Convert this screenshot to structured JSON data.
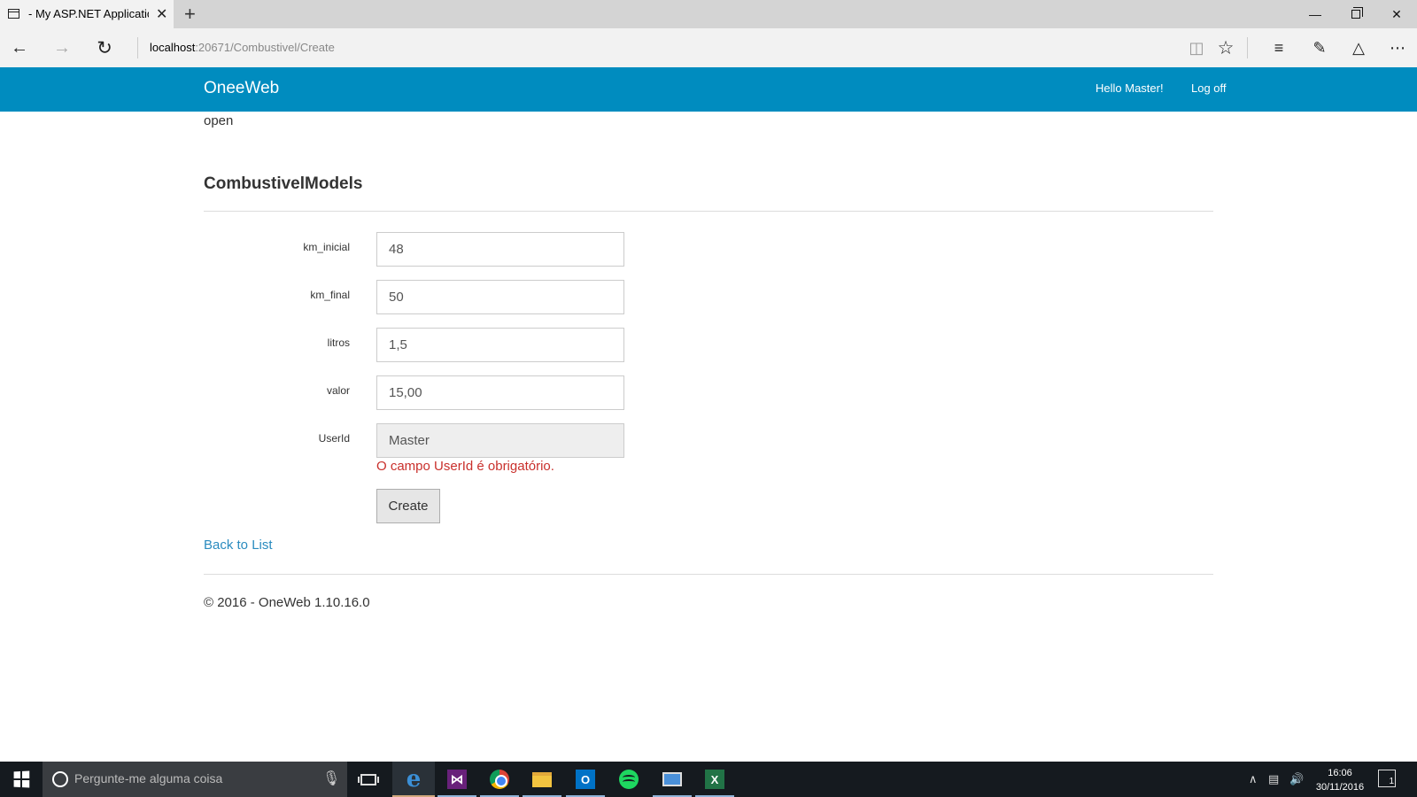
{
  "browser": {
    "tab_title": "- My ASP.NET Applicatio",
    "tab_close": "✕",
    "new_tab": "+",
    "url_host": "localhost",
    "url_rest": ":20671/Combustivel/Create",
    "window_minimize": "—",
    "window_close": "✕"
  },
  "site": {
    "brand": "OneeWeb",
    "hello": "Hello Master!",
    "logoff": "Log off"
  },
  "page": {
    "status_text": "open",
    "heading": "CombustivelModels",
    "fields": [
      {
        "label": "km_inicial",
        "value": "48"
      },
      {
        "label": "km_final",
        "value": "50"
      },
      {
        "label": "litros",
        "value": "1,5"
      },
      {
        "label": "valor",
        "value": "15,00"
      },
      {
        "label": "UserId",
        "value": "Master"
      }
    ],
    "error": "O campo UserId é obrigatório.",
    "create_label": "Create",
    "back_link": "Back to List",
    "footer": "© 2016 - OneWeb 1.10.16.0"
  },
  "taskbar": {
    "search_placeholder": "Pergunte-me alguma coisa",
    "time": "16:06",
    "date": "30/11/2016",
    "notification_count": "1",
    "apps": [
      "edge-icon",
      "visual-studio-icon",
      "chrome-icon",
      "file-explorer-icon",
      "outlook-icon",
      "spotify-icon",
      "remote-desktop-icon",
      "excel-icon"
    ]
  },
  "colors": {
    "header": "#008cbf",
    "error": "#c9302c",
    "link": "#2a8bbf",
    "taskbar": "#151a1f"
  }
}
